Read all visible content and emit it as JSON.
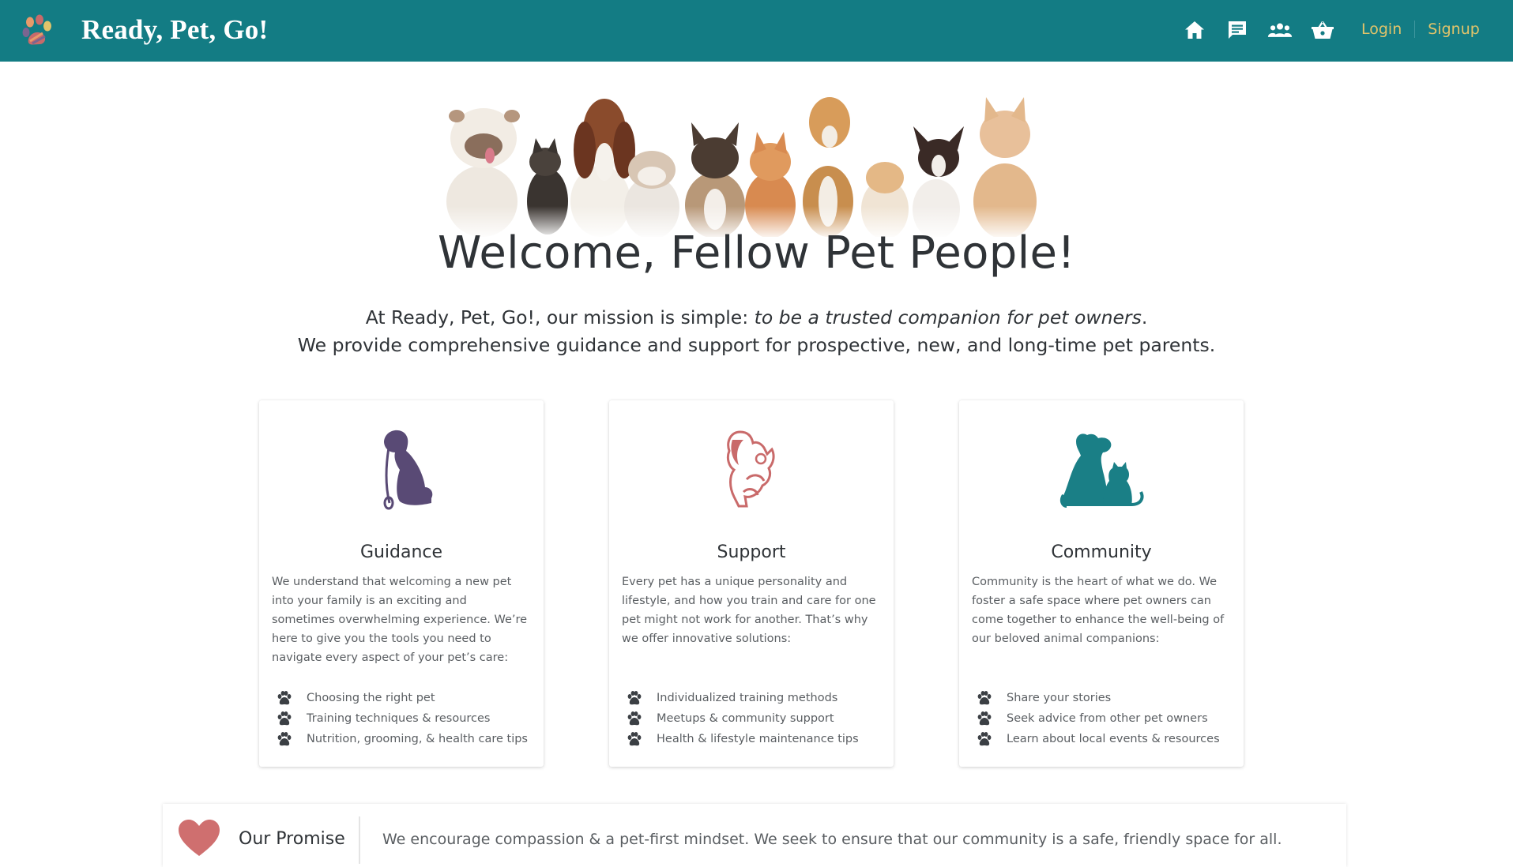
{
  "header": {
    "brand": "Ready, Pet, Go!",
    "bg_color": "#137c84",
    "nav_icons": [
      "home-icon",
      "chat-icon",
      "community-icon",
      "basket-icon"
    ],
    "login_label": "Login",
    "signup_label": "Signup",
    "link_color": "#e2c46a"
  },
  "hero": {
    "title": "Welcome, Fellow Pet People!",
    "mission_lead": "At Ready, Pet, Go!, our mission is simple: ",
    "mission_emphasis": "to be a trusted companion for pet owners",
    "mission_end": ".",
    "mission_line2": "We provide comprehensive guidance and support for prospective, new, and long-time pet parents."
  },
  "cards": [
    {
      "icon": "dog-on-leash-icon",
      "title": "Guidance",
      "body": "We understand that welcoming a new pet into your family is an exciting and sometimes overwhelming experience. We’re here to give you the tools you need to navigate every aspect of your pet’s care:",
      "items": [
        "Choosing the right pet",
        "Training techniques & resources",
        "Nutrition, grooming, & health care tips"
      ],
      "color": "#594a75"
    },
    {
      "icon": "person-hugging-cat-icon",
      "title": "Support",
      "body": "Every pet has a unique personality and lifestyle, and how you train and care for one pet might not work for another. That’s why we offer innovative solutions:",
      "items": [
        "Individualized training methods",
        "Meetups & community support",
        "Health & lifestyle maintenance tips"
      ],
      "color": "#c96a6a"
    },
    {
      "icon": "dog-and-cat-icon",
      "title": "Community",
      "body": "Community is the heart of what we do. We foster a safe space where pet owners can come together to enhance the well-being of our beloved animal companions:",
      "items": [
        "Share your stories",
        "Seek advice from other pet owners",
        "Learn about local events & resources"
      ],
      "color": "#1a7f86"
    }
  ],
  "promise": {
    "icon": "heart-icon",
    "title": "Our Promise",
    "text": "We encourage compassion & a pet-first mindset. We seek to ensure that our community is a safe, friendly space for all."
  }
}
